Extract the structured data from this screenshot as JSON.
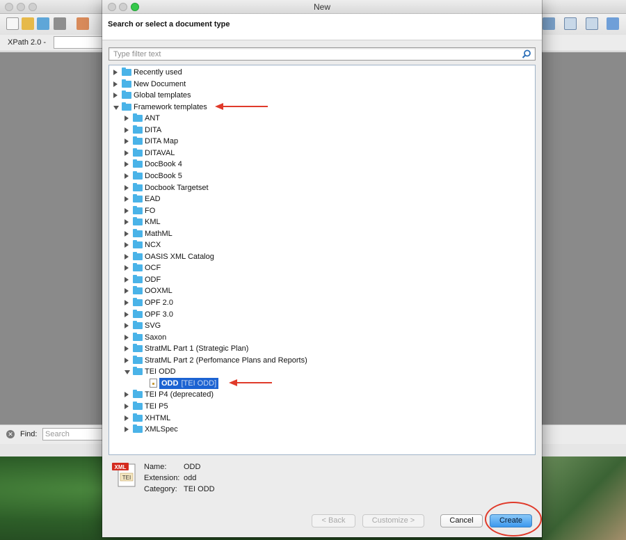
{
  "app": {
    "xpath_label": "XPath 2.0 -",
    "find_label": "Find:",
    "find_placeholder": "Search"
  },
  "dialog": {
    "title": "New",
    "heading": "Search or select a document type",
    "filter_placeholder": "Type filter text",
    "tree": [
      {
        "label": "Recently used",
        "level": 0,
        "expanded": false
      },
      {
        "label": "New Document",
        "level": 0,
        "expanded": false
      },
      {
        "label": "Global templates",
        "level": 0,
        "expanded": false
      },
      {
        "label": "Framework templates",
        "level": 0,
        "expanded": true
      },
      {
        "label": "ANT",
        "level": 1,
        "expanded": false
      },
      {
        "label": "DITA",
        "level": 1,
        "expanded": false
      },
      {
        "label": "DITA Map",
        "level": 1,
        "expanded": false
      },
      {
        "label": "DITAVAL",
        "level": 1,
        "expanded": false
      },
      {
        "label": "DocBook 4",
        "level": 1,
        "expanded": false
      },
      {
        "label": "DocBook 5",
        "level": 1,
        "expanded": false
      },
      {
        "label": "Docbook Targetset",
        "level": 1,
        "expanded": false
      },
      {
        "label": "EAD",
        "level": 1,
        "expanded": false
      },
      {
        "label": "FO",
        "level": 1,
        "expanded": false
      },
      {
        "label": "KML",
        "level": 1,
        "expanded": false
      },
      {
        "label": "MathML",
        "level": 1,
        "expanded": false
      },
      {
        "label": "NCX",
        "level": 1,
        "expanded": false
      },
      {
        "label": "OASIS XML Catalog",
        "level": 1,
        "expanded": false
      },
      {
        "label": "OCF",
        "level": 1,
        "expanded": false
      },
      {
        "label": "ODF",
        "level": 1,
        "expanded": false
      },
      {
        "label": "OOXML",
        "level": 1,
        "expanded": false
      },
      {
        "label": "OPF 2.0",
        "level": 1,
        "expanded": false
      },
      {
        "label": "OPF 3.0",
        "level": 1,
        "expanded": false
      },
      {
        "label": "SVG",
        "level": 1,
        "expanded": false
      },
      {
        "label": "Saxon",
        "level": 1,
        "expanded": false
      },
      {
        "label": "StratML Part 1 (Strategic Plan)",
        "level": 1,
        "expanded": false
      },
      {
        "label": "StratML Part 2 (Perfomance Plans and Reports)",
        "level": 1,
        "expanded": false
      },
      {
        "label": "TEI ODD",
        "level": 1,
        "expanded": true
      },
      {
        "label": "ODD",
        "sublabel": "[TEI ODD]",
        "level": 2,
        "selected": true
      },
      {
        "label": "TEI P4 (deprecated)",
        "level": 1,
        "expanded": false
      },
      {
        "label": "TEI P5",
        "level": 1,
        "expanded": false
      },
      {
        "label": "XHTML",
        "level": 1,
        "expanded": false
      },
      {
        "label": "XMLSpec",
        "level": 1,
        "expanded": false
      }
    ],
    "info": {
      "name_label": "Name:",
      "name_value": "ODD",
      "extension_label": "Extension:",
      "extension_value": "odd",
      "category_label": "Category:",
      "category_value": "TEI ODD",
      "icon_badge": "XML",
      "icon_text": "TEI"
    },
    "buttons": {
      "back": "< Back",
      "customize": "Customize >",
      "cancel": "Cancel",
      "create": "Create"
    }
  },
  "colors": {
    "folder": "#4ab3e8",
    "selection": "#1c63d2",
    "annotation_red": "#e03a2a",
    "primary_button": "#3d98ee"
  }
}
